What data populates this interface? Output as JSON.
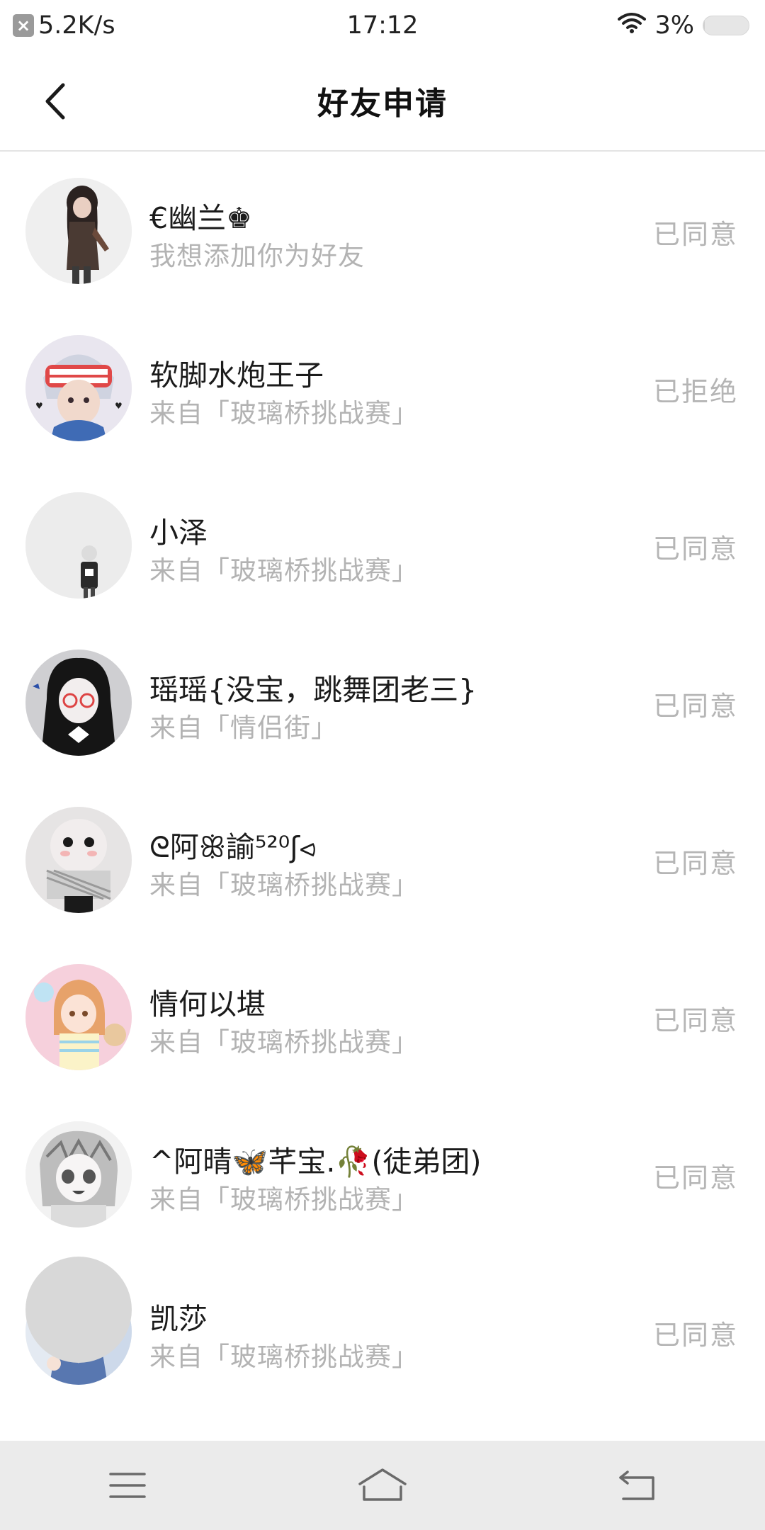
{
  "status_bar": {
    "speed": "5.2K/s",
    "time": "17:12",
    "battery": "3%",
    "battery_level": 0.03
  },
  "header": {
    "title": "好友申请"
  },
  "requests": [
    {
      "name": "€幽兰♚",
      "subtitle": "我想添加你为好友",
      "status": "已同意",
      "avatar": "avatar-girl-dark-hair"
    },
    {
      "name": "软脚水炮王子",
      "subtitle": "来自「玻璃桥挑战赛」",
      "status": "已拒绝",
      "avatar": "avatar-anime-boy-visor"
    },
    {
      "name": "小泽",
      "subtitle": "来自「玻璃桥挑战赛」",
      "status": "已同意",
      "avatar": "avatar-small-figure"
    },
    {
      "name": "瑶瑶{没宝，跳舞团老三}",
      "subtitle": "来自「情侣街」",
      "status": "已同意",
      "avatar": "avatar-girl-glasses"
    },
    {
      "name": "ᘓ阿ꕥ諭⁵²⁰ʃ⪦",
      "subtitle": "来自「玻璃桥挑战赛」",
      "status": "已同意",
      "avatar": "avatar-cute-doll"
    },
    {
      "name": "情何以堪",
      "subtitle": "来自「玻璃桥挑战赛」",
      "status": "已同意",
      "avatar": "avatar-anime-girl-pink"
    },
    {
      "name": "^阿晴🦋芊宝.🥀(徒弟团)",
      "subtitle": "来自「玻璃桥挑战赛」",
      "status": "已同意",
      "avatar": "avatar-anime-girl-gray"
    },
    {
      "name": "凯莎",
      "subtitle": "来自「玻璃桥挑战赛」",
      "status": "已同意",
      "avatar": "avatar-anime-girl-school"
    }
  ],
  "nav": {
    "menu": "menu-icon",
    "home": "home-icon",
    "back": "back-icon"
  }
}
